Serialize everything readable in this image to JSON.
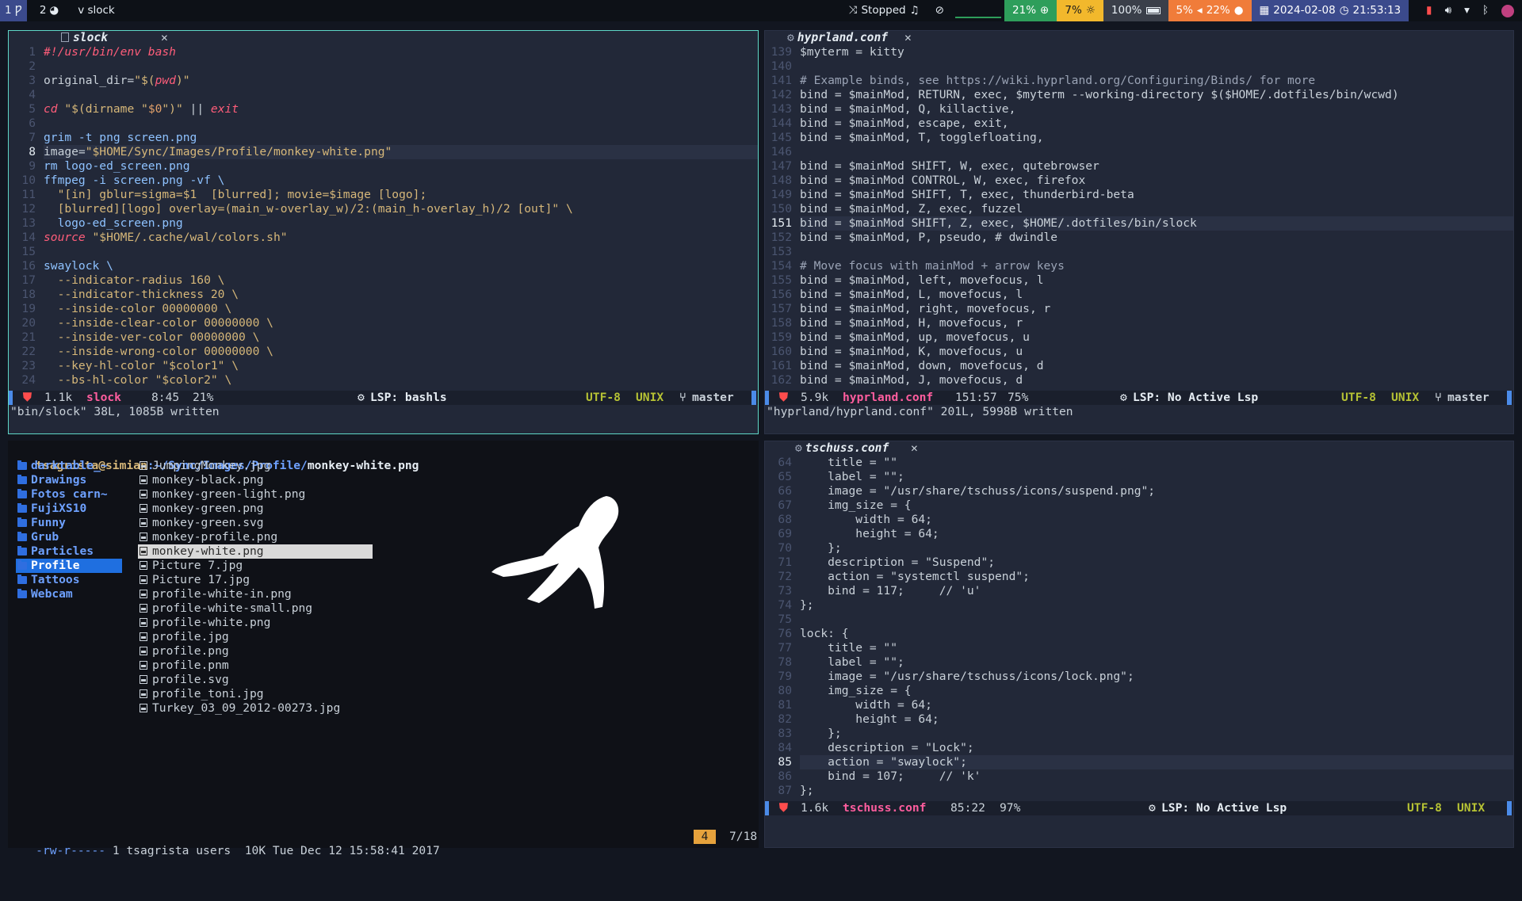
{
  "topbar": {
    "workspaces": [
      {
        "num": "1",
        "icon": "Ƿ",
        "active": true
      },
      {
        "num": "2",
        "icon": "◕",
        "active": false
      }
    ],
    "window_title": "v slock",
    "media_status": "Stopped",
    "cpu": "21%",
    "temp": "7%",
    "battery": "100%",
    "volume_pct": "5%",
    "mic_pct": "22%",
    "date": "2024-02-08",
    "time": "21:53:13",
    "colors": {
      "cpu_bg": "#2e9e5b",
      "temp_bg": "#f2b82c",
      "battery_bg": "#3a3f4a",
      "volume_bg": "#f07c3a",
      "date_bg": "#3b4a8c"
    }
  },
  "pane_slock": {
    "tab": "slock",
    "tab_close": "✕",
    "lines": [
      {
        "n": "1",
        "segs": [
          [
            "#!/usr/bin/env bash",
            "c-com"
          ]
        ]
      },
      {
        "n": "2",
        "segs": []
      },
      {
        "n": "3",
        "segs": [
          [
            "original_dir=",
            "c-plain"
          ],
          [
            "\"$(",
            "c-str"
          ],
          [
            "pwd",
            "c-kw"
          ],
          [
            ")\"",
            "c-str"
          ]
        ]
      },
      {
        "n": "4",
        "segs": []
      },
      {
        "n": "5",
        "segs": [
          [
            "cd",
            "c-kw"
          ],
          [
            " \"$(dirname \"",
            "c-str"
          ],
          [
            "$0",
            "c-var"
          ],
          [
            "\")\" ",
            "c-str"
          ],
          [
            "|| ",
            "c-plain"
          ],
          [
            "exit",
            "c-kw"
          ]
        ]
      },
      {
        "n": "6",
        "segs": []
      },
      {
        "n": "7",
        "segs": [
          [
            "grim -t png screen.png",
            "c-fn"
          ]
        ]
      },
      {
        "n": "8",
        "segs": [
          [
            "image=",
            "c-plain"
          ],
          [
            "\"$HOME/Sync/Images/Profile/monkey-white.png\"",
            "c-str"
          ]
        ],
        "cur": true
      },
      {
        "n": "9",
        "segs": [
          [
            "rm logo-ed_screen.png",
            "c-fn"
          ]
        ]
      },
      {
        "n": "10",
        "segs": [
          [
            "ffmpeg -i screen.png -vf \\",
            "c-fn"
          ]
        ]
      },
      {
        "n": "11",
        "segs": [
          [
            "  \"[in] gblur=sigma=$1  [blurred]; movie=$image [logo];",
            "c-str"
          ]
        ]
      },
      {
        "n": "12",
        "segs": [
          [
            "  [blurred][logo] overlay=(main_w-overlay_w)/2:(main_h-overlay_h)/2 [out]\" \\",
            "c-str"
          ]
        ]
      },
      {
        "n": "13",
        "segs": [
          [
            "  logo-ed_screen.png",
            "c-fn"
          ]
        ]
      },
      {
        "n": "14",
        "segs": [
          [
            "source",
            "c-kw"
          ],
          [
            " \"$HOME/.cache/wal/colors.sh\"",
            "c-str"
          ]
        ]
      },
      {
        "n": "15",
        "segs": []
      },
      {
        "n": "16",
        "segs": [
          [
            "swaylock \\",
            "c-fn"
          ]
        ]
      },
      {
        "n": "17",
        "segs": [
          [
            "  --indicator-radius 160 \\",
            "c-opt"
          ]
        ]
      },
      {
        "n": "18",
        "segs": [
          [
            "  --indicator-thickness 20 \\",
            "c-opt"
          ]
        ]
      },
      {
        "n": "19",
        "segs": [
          [
            "  --inside-color 00000000 \\",
            "c-opt"
          ]
        ]
      },
      {
        "n": "20",
        "segs": [
          [
            "  --inside-clear-color 00000000 \\",
            "c-opt"
          ]
        ]
      },
      {
        "n": "21",
        "segs": [
          [
            "  --inside-ver-color 00000000 \\",
            "c-opt"
          ]
        ]
      },
      {
        "n": "22",
        "segs": [
          [
            "  --inside-wrong-color 00000000 \\",
            "c-opt"
          ]
        ]
      },
      {
        "n": "23",
        "segs": [
          [
            "  --key-hl-color \"$color1\" \\",
            "c-opt"
          ]
        ]
      },
      {
        "n": "24",
        "segs": [
          [
            "  --bs-hl-color \"$color2\" \\",
            "c-opt"
          ]
        ]
      }
    ],
    "status": {
      "size": "1.1k",
      "file": "slock",
      "pos": "8:45",
      "pct": "21%",
      "lsp": "LSP: bashls",
      "enc": "UTF-8",
      "fmt": "UNIX",
      "branch": "master"
    },
    "cmdline": "\"bin/slock\" 38L, 1085B written"
  },
  "pane_hypr": {
    "tab": "hyprland.conf",
    "tab_close": "✕",
    "lines": [
      {
        "n": "139",
        "t": "$myterm = kitty"
      },
      {
        "n": "140",
        "t": ""
      },
      {
        "n": "141",
        "t": "# Example binds, see https://wiki.hyprland.org/Configuring/Binds/ for more"
      },
      {
        "n": "142",
        "t": "bind = $mainMod, RETURN, exec, $myterm --working-directory $($HOME/.dotfiles/bin/wcwd)"
      },
      {
        "n": "143",
        "t": "bind = $mainMod, Q, killactive,"
      },
      {
        "n": "144",
        "t": "bind = $mainMod, escape, exit,"
      },
      {
        "n": "145",
        "t": "bind = $mainMod, T, togglefloating,"
      },
      {
        "n": "146",
        "t": ""
      },
      {
        "n": "147",
        "t": "bind = $mainMod SHIFT, W, exec, qutebrowser"
      },
      {
        "n": "148",
        "t": "bind = $mainMod CONTROL, W, exec, firefox"
      },
      {
        "n": "149",
        "t": "bind = $mainMod SHIFT, T, exec, thunderbird-beta"
      },
      {
        "n": "150",
        "t": "bind = $mainMod, Z, exec, fuzzel"
      },
      {
        "n": "151",
        "t": "bind = $mainMod SHIFT, Z, exec, $HOME/.dotfiles/bin/slock",
        "cur": true
      },
      {
        "n": "152",
        "t": "bind = $mainMod, P, pseudo, # dwindle"
      },
      {
        "n": "153",
        "t": ""
      },
      {
        "n": "154",
        "t": "# Move focus with mainMod + arrow keys"
      },
      {
        "n": "155",
        "t": "bind = $mainMod, left, movefocus, l"
      },
      {
        "n": "156",
        "t": "bind = $mainMod, L, movefocus, l"
      },
      {
        "n": "157",
        "t": "bind = $mainMod, right, movefocus, r"
      },
      {
        "n": "158",
        "t": "bind = $mainMod, H, movefocus, r"
      },
      {
        "n": "159",
        "t": "bind = $mainMod, up, movefocus, u"
      },
      {
        "n": "160",
        "t": "bind = $mainMod, K, movefocus, u"
      },
      {
        "n": "161",
        "t": "bind = $mainMod, down, movefocus, d"
      },
      {
        "n": "162",
        "t": "bind = $mainMod, J, movefocus, d"
      }
    ],
    "status": {
      "size": "5.9k",
      "file": "hyprland.conf",
      "pos": "151:57",
      "pct": "75%",
      "lsp": "LSP: No Active Lsp",
      "enc": "UTF-8",
      "fmt": "UNIX",
      "branch": "master"
    },
    "cmdline": "\"hyprland/hyprland.conf\" 201L, 5998B written"
  },
  "pane_tschuss": {
    "tab": "tschuss.conf",
    "tab_close": "✕",
    "lines": [
      {
        "n": "64",
        "t": "    title = \"\""
      },
      {
        "n": "65",
        "t": "    label = \"\";"
      },
      {
        "n": "66",
        "t": "    image = \"/usr/share/tschuss/icons/suspend.png\";"
      },
      {
        "n": "67",
        "t": "    img_size = {"
      },
      {
        "n": "68",
        "t": "        width = 64;"
      },
      {
        "n": "69",
        "t": "        height = 64;"
      },
      {
        "n": "70",
        "t": "    };"
      },
      {
        "n": "71",
        "t": "    description = \"Suspend\";"
      },
      {
        "n": "72",
        "t": "    action = \"systemctl suspend\";"
      },
      {
        "n": "73",
        "t": "    bind = 117;     // 'u'"
      },
      {
        "n": "74",
        "t": "};"
      },
      {
        "n": "75",
        "t": ""
      },
      {
        "n": "76",
        "t": "lock: {"
      },
      {
        "n": "77",
        "t": "    title = \"\""
      },
      {
        "n": "78",
        "t": "    label = \"\";"
      },
      {
        "n": "79",
        "t": "    image = \"/usr/share/tschuss/icons/lock.png\";"
      },
      {
        "n": "80",
        "t": "    img_size = {"
      },
      {
        "n": "81",
        "t": "        width = 64;"
      },
      {
        "n": "82",
        "t": "        height = 64;"
      },
      {
        "n": "83",
        "t": "    };"
      },
      {
        "n": "84",
        "t": "    description = \"Lock\";"
      },
      {
        "n": "85",
        "t": "    action = \"swaylock\";",
        "cur": true
      },
      {
        "n": "86",
        "t": "    bind = 107;     // 'k'"
      },
      {
        "n": "87",
        "t": "};"
      }
    ],
    "status": {
      "size": "1.6k",
      "file": "tschuss.conf",
      "pos": "85:22",
      "pct": "97%",
      "lsp": "LSP: No Active Lsp",
      "enc": "UTF-8",
      "fmt": "UNIX"
    }
  },
  "filemanager": {
    "path_user": "tsagrista@simian",
    "path_dir": ":~/Sync/Images/Profile/",
    "path_file": "monkey-white.png",
    "dirs": [
      "darktable_~",
      "Drawings",
      "Fotos carn~",
      "FujiXS10",
      "Funny",
      "Grub",
      "Particles",
      "Profile",
      "Tattoos",
      "Webcam"
    ],
    "selected_dir": "Profile",
    "files": [
      "JumpingMonkey.jpg",
      "monkey-black.png",
      "monkey-green-light.png",
      "monkey-green.png",
      "monkey-green.svg",
      "monkey-profile.png",
      "monkey-white.png",
      "Picture 7.jpg",
      "Picture 17.jpg",
      "profile-white-in.png",
      "profile-white-small.png",
      "profile-white.png",
      "profile.jpg",
      "profile.png",
      "profile.pnm",
      "profile.svg",
      "profile_toni.jpg",
      "Turkey_03_09_2012-00273.jpg"
    ],
    "selected_file": "monkey-white.png",
    "status_perms": "-rw-r-----",
    "status_info": " 1 tsagrista users  10K Tue Dec 12 15:58:41 2017",
    "status_badge": "4",
    "status_pos": "7/18"
  }
}
